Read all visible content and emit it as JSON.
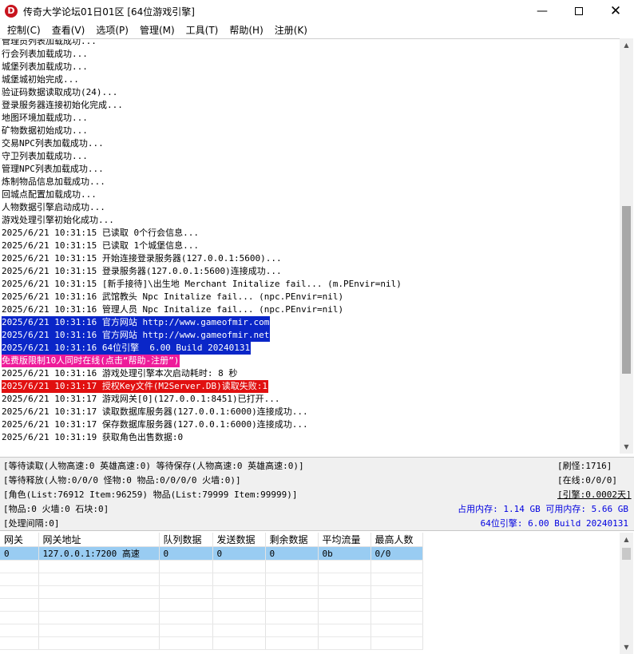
{
  "window": {
    "title": "传奇大学论坛01日01区 [64位游戏引擎]"
  },
  "menu": [
    {
      "label": "控制(C)"
    },
    {
      "label": "查看(V)"
    },
    {
      "label": "选项(P)"
    },
    {
      "label": "管理(M)"
    },
    {
      "label": "工具(T)"
    },
    {
      "label": "帮助(H)"
    },
    {
      "label": "注册(K)"
    }
  ],
  "log": [
    {
      "segments": [
        {
          "text": "管理员列表加载成功..."
        }
      ]
    },
    {
      "segments": [
        {
          "text": "行会列表加载成功..."
        }
      ]
    },
    {
      "segments": [
        {
          "text": "城堡列表加载成功..."
        }
      ]
    },
    {
      "segments": [
        {
          "text": "城堡城初始完成..."
        }
      ]
    },
    {
      "segments": [
        {
          "text": "验证码数据读取成功(24)..."
        }
      ]
    },
    {
      "segments": [
        {
          "text": "登录服务器连接初始化完成..."
        }
      ]
    },
    {
      "segments": [
        {
          "text": "地图环境加载成功..."
        }
      ]
    },
    {
      "segments": [
        {
          "text": "矿物数据初始成功..."
        }
      ]
    },
    {
      "segments": [
        {
          "text": "交易NPC列表加载成功..."
        }
      ]
    },
    {
      "segments": [
        {
          "text": "守卫列表加载成功..."
        }
      ]
    },
    {
      "segments": [
        {
          "text": "管理NPC列表加载成功..."
        }
      ]
    },
    {
      "segments": [
        {
          "text": "炼制物品信息加载成功..."
        }
      ]
    },
    {
      "segments": [
        {
          "text": "回城点配置加载成功..."
        }
      ]
    },
    {
      "segments": [
        {
          "text": "人物数据引擎启动成功..."
        }
      ]
    },
    {
      "segments": [
        {
          "text": "游戏处理引擎初始化成功..."
        }
      ]
    },
    {
      "segments": [
        {
          "text": "2025/6/21 10:31:15 已读取 0个行会信息..."
        }
      ]
    },
    {
      "segments": [
        {
          "text": "2025/6/21 10:31:15 已读取 1个城堡信息..."
        }
      ]
    },
    {
      "segments": [
        {
          "text": "2025/6/21 10:31:15 开始连接登录服务器(127.0.0.1:5600)..."
        }
      ]
    },
    {
      "segments": [
        {
          "text": "2025/6/21 10:31:15 登录服务器(127.0.0.1:5600)连接成功..."
        }
      ]
    },
    {
      "segments": [
        {
          "text": "2025/6/21 10:31:15 [新手接待]\\出生地 Merchant Initalize fail... (m.PEnvir=nil)"
        }
      ]
    },
    {
      "segments": [
        {
          "text": "2025/6/21 10:31:16 武馆教头 Npc Initalize fail... (npc.PEnvir=nil)"
        }
      ]
    },
    {
      "segments": [
        {
          "text": "2025/6/21 10:31:16 管理人员 Npc Initalize fail... (npc.PEnvir=nil)"
        }
      ]
    },
    {
      "segments": [
        {
          "text": "2025/6/21 10:31:16 官方网站 http://www.gameofmir.com",
          "hl": "blue"
        }
      ]
    },
    {
      "segments": [
        {
          "text": "2025/6/21 10:31:16 官方网站 http://www.gameofmir.net",
          "hl": "blue"
        }
      ]
    },
    {
      "segments": [
        {
          "text": "2025/6/21 10:31:16 64位引擎  6.00 Build 20240131",
          "hl": "blue"
        }
      ]
    },
    {
      "segments": [
        {
          "text": "免费版限制10人同时在线(点击“帮助-注册”)",
          "hl": "pink"
        }
      ]
    },
    {
      "segments": [
        {
          "text": "2025/6/21 10:31:16 游戏处理引擎本次启动耗时: 8 秒"
        }
      ]
    },
    {
      "segments": [
        {
          "text": "2025/6/21 10:31:17 授权Key文件(M2Server.DB)读取失败:1",
          "hl": "red"
        }
      ]
    },
    {
      "segments": [
        {
          "text": "2025/6/21 10:31:17 游戏网关[0](127.0.0.1:8451)已打开..."
        }
      ]
    },
    {
      "segments": [
        {
          "text": "2025/6/21 10:31:17 读取数据库服务器(127.0.0.1:6000)连接成功..."
        }
      ]
    },
    {
      "segments": [
        {
          "text": "2025/6/21 10:31:17 保存数据库服务器(127.0.0.1:6000)连接成功..."
        }
      ]
    },
    {
      "segments": [
        {
          "text": "2025/6/21 10:31:19 获取角色出售数据:0"
        }
      ]
    }
  ],
  "status": {
    "wait_read": "[等待读取(人物高速:0 英雄高速:0) 等待保存(人物高速:0 英雄高速:0)]",
    "wait_release": "[等待释放(人物:0/0/0 怪物:0 物品:0/0/0/0 火墙:0)]",
    "roles": "[角色(List:76912 Item:96259) 物品(List:79999 Item:99999)]",
    "items": "[物品:0 火墙:0 石块:0]",
    "interval": "[处理间隔:0]",
    "refresh_monsters": "[刷怪:1716]",
    "online": "[在线:0/0/0]",
    "engine_time": "[引擎:0.0002天]",
    "memory": "占用内存: 1.14 GB 可用内存: 5.66 GB",
    "engine_version": "64位引擎: 6.00 Build 20240131",
    "accent_color": "#0000e0"
  },
  "gateway_table": {
    "columns": [
      "网关",
      "网关地址",
      "队列数据",
      "发送数据",
      "剩余数据",
      "平均流量",
      "最高人数"
    ],
    "rows": [
      [
        "0",
        "127.0.0.1:7200 高速",
        "0",
        "0",
        "0",
        "0b",
        "0/0"
      ]
    ],
    "selected_color": "#99ccf2"
  },
  "icons": {
    "app": "app-logo-icon",
    "minimize": "minimize-icon",
    "maximize": "maximize-icon",
    "close": "close-icon",
    "scroll_up": "chevron-up-icon",
    "scroll_down": "chevron-down-icon"
  },
  "scroll": {
    "log_position": 0.7,
    "table_position": 0.0
  },
  "highlight_colors": {
    "blue": "#0a26c8",
    "pink": "#ee1b9a",
    "red": "#e11010"
  }
}
